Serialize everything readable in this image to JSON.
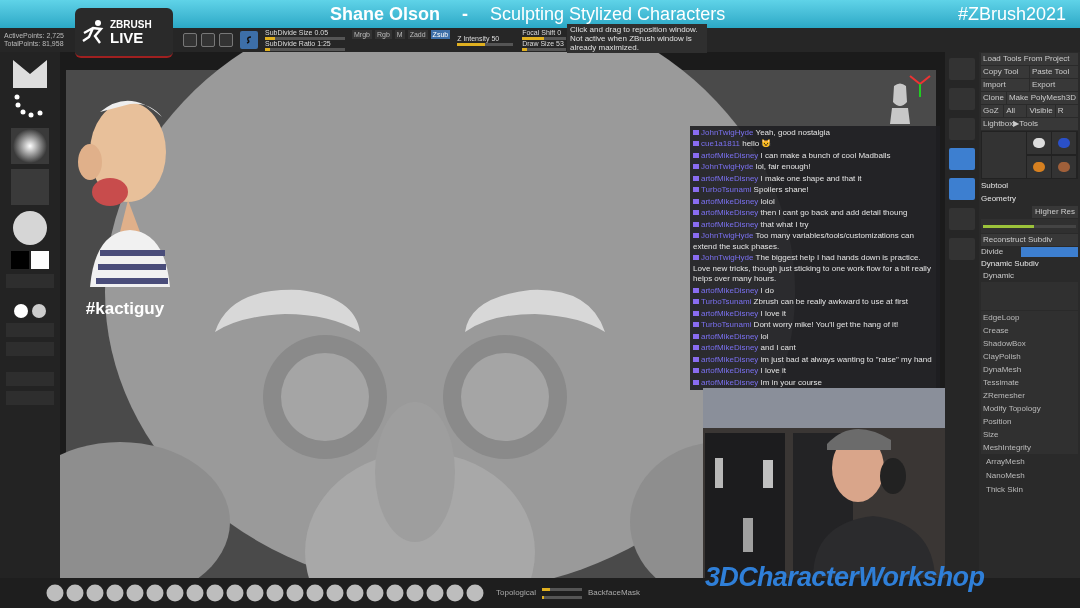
{
  "banner": {
    "presenter": "Shane Olson",
    "separator": "-",
    "title": "Sculpting Stylized Characters",
    "hashtag": "#ZBrush2021"
  },
  "logo": {
    "line1": "ZBRUSH",
    "line2": "LIVE"
  },
  "stats": [
    "ActivePoints: 2,725",
    "TotalPoints: 81,958"
  ],
  "toolbar": {
    "modes": [
      {
        "selected": false
      },
      {
        "selected": false
      },
      {
        "selected": false
      }
    ],
    "sliders": [
      {
        "label": "SubDivide Size 0.05",
        "level": 0.12
      },
      {
        "label": "SubDivide Ratio 1:25",
        "level": 0.06
      }
    ],
    "channels": [
      {
        "label": "Mrgb",
        "selected": false
      },
      {
        "label": "Rgb",
        "selected": false
      },
      {
        "label": "M",
        "selected": false
      },
      {
        "label": "Zadd",
        "selected": false
      },
      {
        "label": "Zsub",
        "selected": true
      }
    ],
    "intensity": {
      "label": "Z Intensity 50",
      "level": 0.5
    },
    "right_sliders": [
      {
        "label": "Focal Shift 0",
        "level": 0.5
      },
      {
        "label": "Draw Size 53",
        "level": 0.12
      }
    ]
  },
  "tooltip": "Click and drag to reposition window. Not active when ZBrush window is already maximized.",
  "left_shelf": [
    {
      "kind": "brush"
    },
    {
      "kind": "stroke"
    },
    {
      "kind": "alpha"
    },
    {
      "kind": "texture"
    },
    {
      "kind": "material"
    },
    {
      "kind": "colors"
    },
    {
      "kind": "button"
    },
    {
      "kind": "blank"
    },
    {
      "kind": "materials"
    },
    {
      "kind": "button"
    },
    {
      "kind": "button"
    },
    {
      "kind": "blank"
    },
    {
      "kind": "button"
    },
    {
      "kind": "button"
    }
  ],
  "caricature_tag": "#kactiguy",
  "chat": [
    {
      "user": "JohnTwigHyde",
      "message": "Yeah, good nostalgia"
    },
    {
      "user": "cue1a1811",
      "message": "hello 😺"
    },
    {
      "user": "artofMikeDisney",
      "message": "I can make a bunch of cool Madballs"
    },
    {
      "user": "JohnTwigHyde",
      "message": "lol, fair enough!"
    },
    {
      "user": "artofMikeDisney",
      "message": "I make one shape and that it"
    },
    {
      "user": "TurboTsunami",
      "message": "Spoilers shane!"
    },
    {
      "user": "artofMikeDisney",
      "message": "lolol"
    },
    {
      "user": "artofMikeDisney",
      "message": "then I cant go back and add detail thoung"
    },
    {
      "user": "artofMikeDisney",
      "message": "that what I try"
    },
    {
      "user": "JohnTwigHyde",
      "message": "Too many variables/tools/customizations can extend the suck phases."
    },
    {
      "user": "JohnTwigHyde",
      "message": "The biggest help I had hands down is practice. Love new tricks, though just sticking to one work flow for a bit really helps over many hours."
    },
    {
      "user": "artofMikeDisney",
      "message": "I do"
    },
    {
      "user": "TurboTsunami",
      "message": "Zbrush can be really awkward to use at first"
    },
    {
      "user": "artofMikeDisney",
      "message": "I love it"
    },
    {
      "user": "TurboTsunami",
      "message": "Dont worry mike! You'll get the hang of it!"
    },
    {
      "user": "artofMikeDisney",
      "message": "lol"
    },
    {
      "user": "artofMikeDisney",
      "message": "and I cant"
    },
    {
      "user": "artofMikeDisney",
      "message": "im just bad at always wanting to \"raise\" my hand"
    },
    {
      "user": "artofMikeDisney",
      "message": "I love it"
    },
    {
      "user": "artofMikeDisney",
      "message": "Im in your course"
    }
  ],
  "workshop_logo": "3DCharacterWorkshop",
  "right_strip": [
    {
      "selected": false
    },
    {
      "selected": false
    },
    {
      "selected": false
    },
    {
      "selected": true
    },
    {
      "selected": true
    },
    {
      "selected": false
    },
    {
      "selected": false
    }
  ],
  "tool_panel": {
    "rows": [
      [
        "Load Tools From Project"
      ],
      [
        "Copy Tool",
        "Paste Tool"
      ],
      [
        "Import",
        "Export"
      ],
      [
        "Clone",
        "Make PolyMesh3D"
      ],
      [
        "GoZ",
        "All",
        "Visible",
        "R"
      ],
      [
        "Lightbox▶Tools"
      ]
    ],
    "subtool": "Subtool",
    "geometry": "Geometry",
    "higher_res": "Higher Res",
    "subdiv_slider": {
      "level": 0.55
    },
    "reconstruct": "Reconstruct Subdiv",
    "divide": "Divide",
    "dynamic_subdiv": "Dynamic Subdiv",
    "dynamic": "Dynamic",
    "list": [
      "EdgeLoop",
      "Crease",
      "ShadowBox",
      "ClayPolish",
      "DynaMesh",
      "Tessimate",
      "ZRemesher",
      "Modify Topology",
      "Position",
      "Size",
      "MeshIntegrity"
    ],
    "more": [
      "ArrayMesh",
      "NanoMesh",
      "Thick Skin"
    ]
  },
  "bottom_right": {
    "topological": "Topological",
    "range": {
      "level": 0.2
    },
    "backface": "BackfaceMask",
    "polygroups": {
      "level": 0.05
    }
  }
}
